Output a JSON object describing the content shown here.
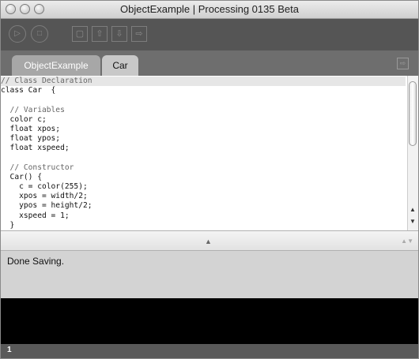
{
  "window": {
    "title": "ObjectExample | Processing 0135 Beta"
  },
  "toolbar": {
    "buttons": [
      {
        "name": "run",
        "icon": "play-icon"
      },
      {
        "name": "stop",
        "icon": "stop-icon"
      },
      {
        "name": "new",
        "icon": "new-file-icon"
      },
      {
        "name": "open",
        "icon": "open-icon"
      },
      {
        "name": "save",
        "icon": "save-icon"
      },
      {
        "name": "export",
        "icon": "export-icon"
      }
    ]
  },
  "tabs": [
    {
      "label": "ObjectExample",
      "active": true
    },
    {
      "label": "Car",
      "active": false
    }
  ],
  "editor": {
    "lines": [
      "// Class Declaration",
      "class Car  {",
      "",
      "  // Variables",
      "  color c;",
      "  float xpos;",
      "  float ypos;",
      "  float xspeed;",
      "",
      "  // Constructor",
      "  Car() {",
      "    c = color(255);",
      "    xpos = width/2;",
      "    ypos = height/2;",
      "    xspeed = 1;",
      "  }"
    ]
  },
  "status": {
    "message": "Done Saving."
  },
  "footer": {
    "line_number": "1"
  },
  "colors": {
    "toolbar_bg": "#555555",
    "tabbar_bg": "#6e6e6e",
    "active_tab": "#a7a7a7",
    "status_bg": "#d3d3d3",
    "console_bg": "#000000"
  }
}
